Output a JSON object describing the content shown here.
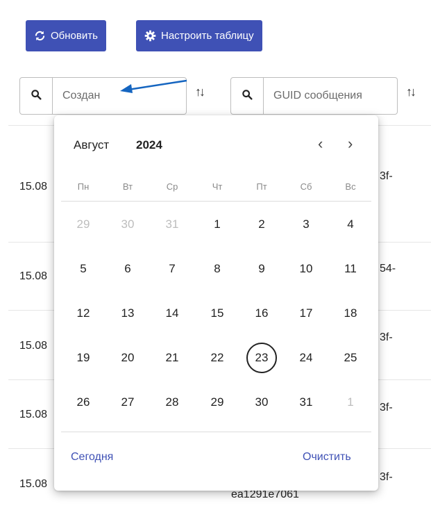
{
  "toolbar": {
    "refresh_label": "Обновить",
    "configure_label": "Настроить таблицу"
  },
  "filters": {
    "created": {
      "value": "Создан"
    },
    "guid": {
      "value": "GUID сообщения"
    }
  },
  "rows": [
    {
      "date": "15.08",
      "tail": "3f-"
    },
    {
      "date": "15.08",
      "tail": "54-"
    },
    {
      "date": "15.08",
      "tail": "3f-"
    },
    {
      "date": "15.08",
      "tail": "3f-"
    },
    {
      "date": "15.08",
      "tail": "3f-",
      "extra": "ea1291e7061"
    }
  ],
  "calendar": {
    "month": "Август",
    "year": "2024",
    "weekdays": [
      "Пн",
      "Вт",
      "Ср",
      "Чт",
      "Пт",
      "Сб",
      "Вс"
    ],
    "weeks": [
      [
        "29",
        "30",
        "31",
        "1",
        "2",
        "3",
        "4"
      ],
      [
        "5",
        "6",
        "7",
        "8",
        "9",
        "10",
        "11"
      ],
      [
        "12",
        "13",
        "14",
        "15",
        "16",
        "17",
        "18"
      ],
      [
        "19",
        "20",
        "21",
        "22",
        "23",
        "24",
        "25"
      ],
      [
        "26",
        "27",
        "28",
        "29",
        "30",
        "31",
        "1"
      ]
    ],
    "today_label": "Сегодня",
    "clear_label": "Очистить"
  },
  "colors": {
    "accent": "#3f51b5",
    "arrow": "#1565c0"
  }
}
